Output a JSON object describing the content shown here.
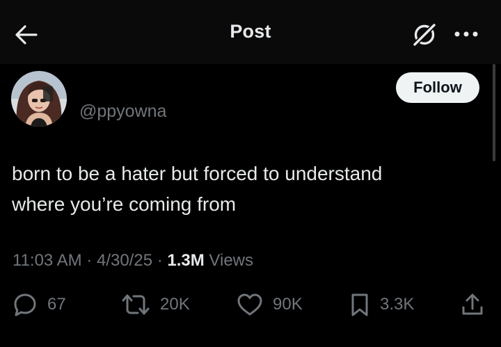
{
  "header": {
    "title": "Post",
    "back_icon": "arrow-left-icon",
    "grok_icon": "grok-icon",
    "more_icon": "more-dots-icon"
  },
  "author": {
    "handle": "@ppyowna",
    "follow_label": "Follow"
  },
  "tweet": {
    "text_line1": "born to be a hater but forced to understand",
    "text_line2": "where you’re coming from",
    "time": "11:03 AM",
    "date": "4/30/25",
    "separator": "·",
    "views_count": "1.3M",
    "views_label": "Views"
  },
  "actions": {
    "replies": "67",
    "reposts": "20K",
    "likes": "90K",
    "bookmarks": "3.3K"
  },
  "colors": {
    "background": "#000000",
    "header_bg": "#0a0a0b",
    "text_primary": "#e7e9ea",
    "text_secondary": "#71767b",
    "follow_bg": "#eff3f4"
  }
}
